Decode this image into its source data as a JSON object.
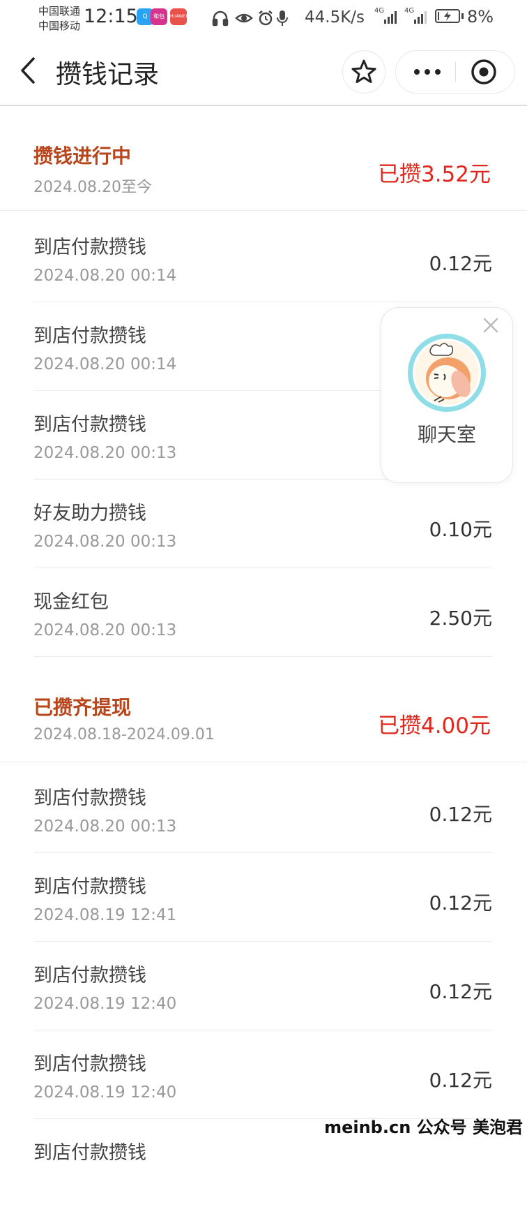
{
  "status_bar": {
    "carrier_1": "中国联通",
    "carrier_2": "中国移动",
    "time": "12:15",
    "app_badges": [
      "Q",
      "和包",
      "HUAWEI"
    ],
    "net_speed": "44.5K/s",
    "signal_1": "4G",
    "signal_2": "4G",
    "battery": "8%",
    "battery_level": 0.08
  },
  "nav": {
    "title": "攒钱记录"
  },
  "groups": [
    {
      "title": "攒钱进行中",
      "period": "2024.08.20至今",
      "total": "已攒3.52元",
      "records": [
        {
          "title": "到店付款攒钱",
          "time": "2024.08.20 00:14",
          "amount": "0.12元"
        },
        {
          "title": "到店付款攒钱",
          "time": "2024.08.20 00:14",
          "amount": ""
        },
        {
          "title": "到店付款攒钱",
          "time": "2024.08.20 00:13",
          "amount": ""
        },
        {
          "title": "好友助力攒钱",
          "time": "2024.08.20 00:13",
          "amount": "0.10元"
        },
        {
          "title": "现金红包",
          "time": "2024.08.20 00:13",
          "amount": "2.50元"
        }
      ]
    },
    {
      "title": "已攒齐提现",
      "period": "2024.08.18-2024.09.01",
      "total": "已攒4.00元",
      "records": [
        {
          "title": "到店付款攒钱",
          "time": "2024.08.20 00:13",
          "amount": "0.12元"
        },
        {
          "title": "到店付款攒钱",
          "time": "2024.08.19 12:41",
          "amount": "0.12元"
        },
        {
          "title": "到店付款攒钱",
          "time": "2024.08.19 12:40",
          "amount": "0.12元"
        },
        {
          "title": "到店付款攒钱",
          "time": "2024.08.19 12:40",
          "amount": "0.12元"
        },
        {
          "title": "到店付款攒钱",
          "time": "",
          "amount": ""
        }
      ]
    }
  ],
  "chat_room": {
    "label": "聊天室"
  },
  "watermark": "meinb.cn 公众号 美泡君",
  "colors": {
    "group_title": "#b8461c",
    "total_red": "#e0251a",
    "text_gray": "#999999"
  }
}
